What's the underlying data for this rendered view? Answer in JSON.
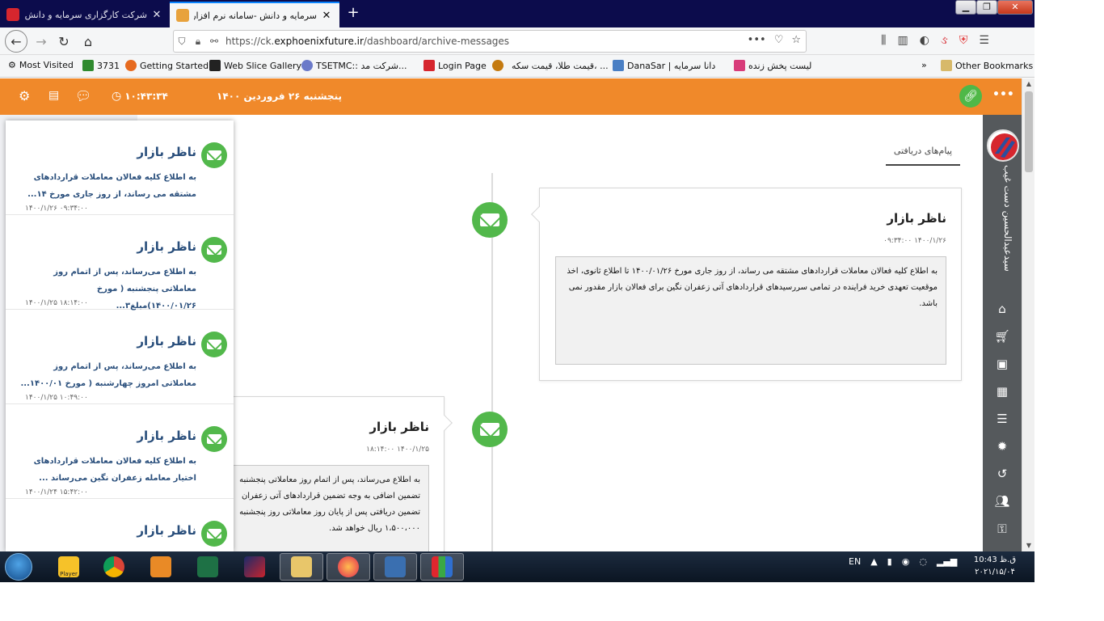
{
  "browser": {
    "tabs": [
      {
        "title": "شرکت کارگزاری سرمایه و دانش",
        "active": false
      },
      {
        "title": "سرمایه و دانش -سامانه نرم افزاری",
        "active": true
      }
    ],
    "url_prefix": "https://ck.",
    "url_domain": "exphoenixfuture.ir",
    "url_path": "/dashboard/archive-messages",
    "bookmarks": [
      "Most Visited",
      "3731",
      "Getting Started",
      "Web Slice Gallery",
      "TSETMC:: شرکت مد...",
      "Login Page",
      "قیمت طلا، قیمت سکه، ...",
      "DanaSar | دانا سرمایه",
      "لیست پخش زنده",
      "Other Bookmarks"
    ]
  },
  "header": {
    "clock": "۱۰:۴۳:۳۴",
    "date": "پنجشنبه ۲۶ فروردین ۱۴۰۰"
  },
  "page": {
    "title": "پیام‌های دریافتی"
  },
  "messages": [
    {
      "title": "ناظر بازار",
      "time": "۱۴۰۰/۱/۲۶ ۰۹:۳۴:۰۰",
      "body": "به اطلاع کلیه فعالان معاملات قراردادهای مشتقه می رساند، از روز جاری مورخ ۱۴۰۰/۰۱/۲۶ تا اطلاع ثانوی، اخذ موقعیت تعهدی خرید فراینده در تمامی سررسیدهای قراردادهای آتی زعفران نگین برای فعالان بازار مقدور نمی باشد."
    },
    {
      "title": "ناظر بازار",
      "time": "۱۴۰۰/۱/۲۵ ۱۸:۱۴:۰۰",
      "body_lines": [
        "به اطلاع می‌رساند، پس از اتمام روز معاملاتی پنجشنبه",
        "تضمین اضافی به وجه تضمین قراردادهای آتی زعفران",
        "تضمین دریافتی پس از پایان روز معاملاتی روز پنجشنبه",
        "۱،۵۰۰،۰۰۰ ریال خواهد شد."
      ]
    }
  ],
  "notifications": [
    {
      "title": "ناظر بازار",
      "text": "به اطلاع کلیه فعالان معاملات قراردادهای مشتقه می رساند، از روز جاری مورخ ۱۴...",
      "time": "۱۴۰۰/۱/۲۶ ۰۹:۳۴:۰۰"
    },
    {
      "title": "ناظر بازار",
      "text": "به اطلاع می‌رساند، پس از اتمام روز معاملاتی پنجشنبه ( مورخ ۱۴۰۰/۰۱/۲۶)مبلغ۳...",
      "time": "۱۴۰۰/۱/۲۵ ۱۸:۱۴:۰۰"
    },
    {
      "title": "ناظر بازار",
      "text": "به اطلاع می‌رساند، پس از اتمام روز معاملاتی امروز چهارشنبه ( مورخ ۱۴۰۰/۰۱...",
      "time": "۱۴۰۰/۱/۲۵ ۱۰:۴۹:۰۰"
    },
    {
      "title": "ناظر بازار",
      "text": "به اطلاع کلیه فعالان معاملات قراردادهای اختیار معامله زعفران نگین می‌رساند ...",
      "time": "۱۴۰۰/۱/۲۴ ۱۵:۴۲:۰۰"
    },
    {
      "title": "ناظر بازار",
      "text": "",
      "time": ""
    }
  ],
  "user": {
    "name": "سیدعبدالحسین دست غیب"
  },
  "taskbar": {
    "player_label": "Player",
    "lang": "EN",
    "time": "10:43 ق.ظ",
    "date": "۲۰۲۱/۱۵/۰۴"
  },
  "colors": {
    "header": "#f0892a",
    "accent_green": "#52b84b",
    "sidebar": "#55595c"
  },
  "icons": [
    "gear-icon",
    "card-icon",
    "chat-icon",
    "clock-icon",
    "link-icon",
    "home-icon",
    "cart-icon",
    "money-icon",
    "calculator-icon",
    "list-icon",
    "badge-icon",
    "history-icon",
    "users-icon",
    "key-icon"
  ]
}
